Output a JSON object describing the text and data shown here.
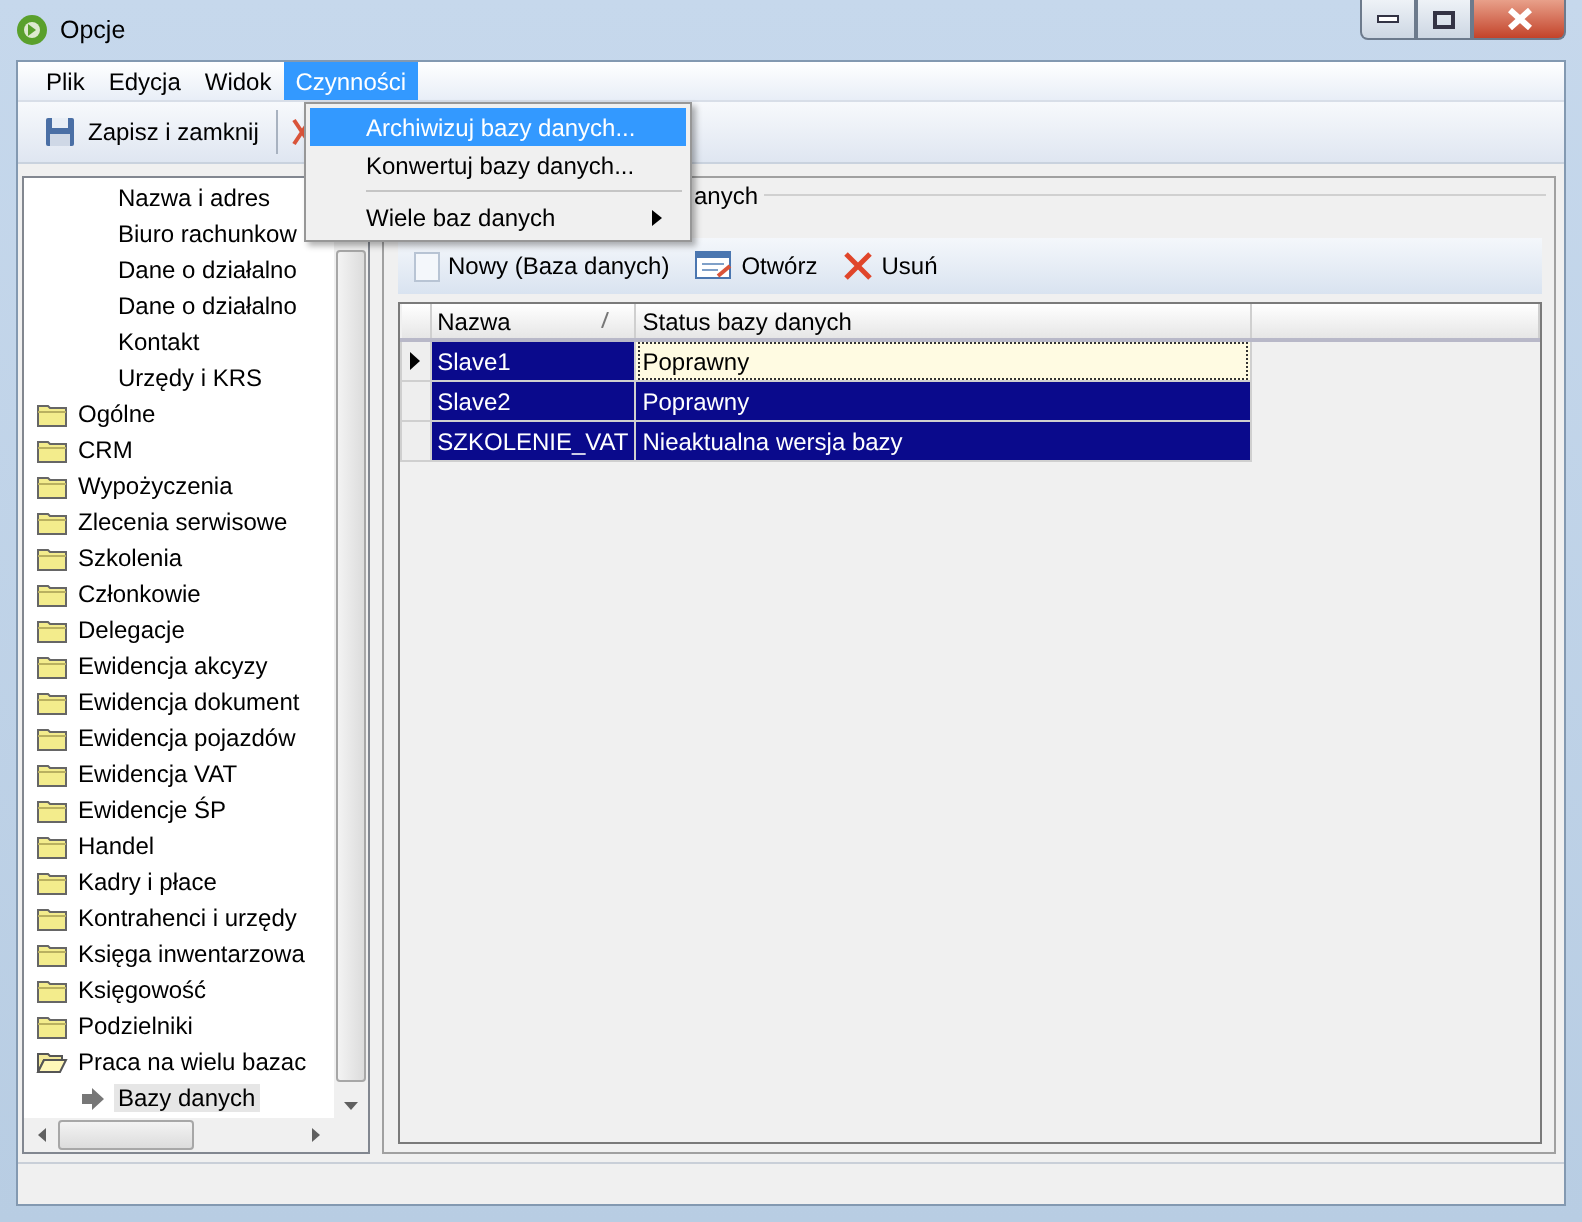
{
  "window": {
    "title": "Opcje"
  },
  "menu_bar": [
    {
      "label": "Plik",
      "selected": false
    },
    {
      "label": "Edycja",
      "selected": false
    },
    {
      "label": "Widok",
      "selected": false
    },
    {
      "label": "Czynności",
      "selected": true
    }
  ],
  "dropdown": [
    {
      "kind": "item",
      "label": "Archiwizuj bazy danych...",
      "selected": true
    },
    {
      "kind": "item",
      "label": "Konwertuj bazy danych...",
      "selected": false
    },
    {
      "kind": "separator"
    },
    {
      "kind": "submenu",
      "label": "Wiele baz danych",
      "selected": false
    }
  ],
  "toolbar": {
    "save_label": "Zapisz i zamknij"
  },
  "tree": [
    {
      "kind": "page",
      "label": "Nazwa i adres",
      "selected": false
    },
    {
      "kind": "page",
      "label": "Biuro rachunkow",
      "selected": false
    },
    {
      "kind": "page",
      "label": "Dane o działalno",
      "selected": false
    },
    {
      "kind": "page",
      "label": "Dane o działalno",
      "selected": false
    },
    {
      "kind": "page",
      "label": "Kontakt",
      "selected": false
    },
    {
      "kind": "page",
      "label": "Urzędy i KRS",
      "selected": false
    },
    {
      "kind": "folder",
      "label": "Ogólne",
      "expanded": false,
      "selected": false
    },
    {
      "kind": "folder",
      "label": "CRM",
      "expanded": false,
      "selected": false
    },
    {
      "kind": "folder",
      "label": "Wypożyczenia",
      "expanded": false,
      "selected": false
    },
    {
      "kind": "folder",
      "label": "Zlecenia serwisowe",
      "expanded": false,
      "selected": false
    },
    {
      "kind": "folder",
      "label": "Szkolenia",
      "expanded": false,
      "selected": false
    },
    {
      "kind": "folder",
      "label": "Członkowie",
      "expanded": false,
      "selected": false
    },
    {
      "kind": "folder",
      "label": "Delegacje",
      "expanded": false,
      "selected": false
    },
    {
      "kind": "folder",
      "label": "Ewidencja akcyzy",
      "expanded": false,
      "selected": false
    },
    {
      "kind": "folder",
      "label": "Ewidencja dokument",
      "expanded": false,
      "selected": false
    },
    {
      "kind": "folder",
      "label": "Ewidencja pojazdów",
      "expanded": false,
      "selected": false
    },
    {
      "kind": "folder",
      "label": "Ewidencja VAT",
      "expanded": false,
      "selected": false
    },
    {
      "kind": "folder",
      "label": "Ewidencje ŚP",
      "expanded": false,
      "selected": false
    },
    {
      "kind": "folder",
      "label": "Handel",
      "expanded": false,
      "selected": false
    },
    {
      "kind": "folder",
      "label": "Kadry i płace",
      "expanded": false,
      "selected": false
    },
    {
      "kind": "folder",
      "label": "Kontrahenci i urzędy",
      "expanded": false,
      "selected": false
    },
    {
      "kind": "folder",
      "label": "Księga inwentarzowa",
      "expanded": false,
      "selected": false
    },
    {
      "kind": "folder",
      "label": "Księgowość",
      "expanded": false,
      "selected": false
    },
    {
      "kind": "folder",
      "label": "Podzielniki",
      "expanded": false,
      "selected": false
    },
    {
      "kind": "folder",
      "label": "Praca na wielu bazac",
      "expanded": true,
      "selected": false,
      "children": [
        {
          "kind": "page",
          "label": "Bazy danych",
          "selected": true
        }
      ]
    }
  ],
  "panel": {
    "group_title": "anych",
    "actions": [
      {
        "kind": "new",
        "label": "Nowy (Baza danych)"
      },
      {
        "kind": "open",
        "label": "Otwórz"
      },
      {
        "kind": "delete",
        "label": "Usuń"
      }
    ],
    "columns": [
      "Nazwa",
      "Status bazy danych"
    ],
    "rows": [
      {
        "name": "Slave1",
        "status": "Poprawny",
        "selected": true,
        "current": true
      },
      {
        "name": "Slave2",
        "status": "Poprawny",
        "selected": true,
        "current": false
      },
      {
        "name": "SZKOLENIE_VAT",
        "status": "Nieaktualna wersja bazy",
        "selected": true,
        "current": false
      }
    ]
  }
}
